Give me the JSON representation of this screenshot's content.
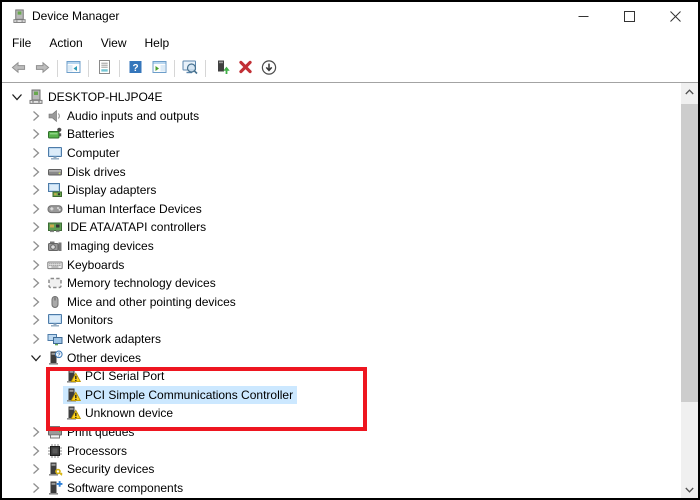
{
  "window": {
    "title": "Device Manager",
    "app_icon": "device-manager-icon",
    "controls": [
      {
        "name": "minimize",
        "icon": "minimize-icon"
      },
      {
        "name": "maximize",
        "icon": "maximize-icon"
      },
      {
        "name": "close",
        "icon": "close-icon"
      }
    ]
  },
  "menu": {
    "items": [
      "File",
      "Action",
      "View",
      "Help"
    ]
  },
  "toolbar": {
    "buttons": [
      {
        "name": "back",
        "icon": "back-arrow"
      },
      {
        "name": "forward",
        "icon": "forward-arrow"
      },
      {
        "sep": true
      },
      {
        "name": "show-console-tree",
        "icon": "console-tree"
      },
      {
        "sep": true
      },
      {
        "name": "properties",
        "icon": "properties"
      },
      {
        "sep": true
      },
      {
        "name": "help",
        "icon": "help"
      },
      {
        "name": "show-action-pane",
        "icon": "action-pane"
      },
      {
        "sep": true
      },
      {
        "name": "scan-for-hardware-changes",
        "icon": "scan"
      },
      {
        "sep": true
      },
      {
        "name": "update-driver",
        "icon": "update-driver"
      },
      {
        "name": "uninstall-device",
        "icon": "uninstall"
      },
      {
        "name": "disable-device",
        "icon": "disable"
      }
    ]
  },
  "tree": {
    "items": [
      {
        "label": "DESKTOP-HLJPO4E",
        "icon": "computer-root",
        "level": 0,
        "state": "expanded",
        "selected": false
      },
      {
        "label": "Audio inputs and outputs",
        "icon": "speaker",
        "level": 1,
        "state": "collapsed",
        "selected": false
      },
      {
        "label": "Batteries",
        "icon": "battery",
        "level": 1,
        "state": "collapsed",
        "selected": false
      },
      {
        "label": "Computer",
        "icon": "monitor",
        "level": 1,
        "state": "collapsed",
        "selected": false
      },
      {
        "label": "Disk drives",
        "icon": "disk",
        "level": 1,
        "state": "collapsed",
        "selected": false
      },
      {
        "label": "Display adapters",
        "icon": "display-adapter",
        "level": 1,
        "state": "collapsed",
        "selected": false
      },
      {
        "label": "Human Interface Devices",
        "icon": "gamepad",
        "level": 1,
        "state": "collapsed",
        "selected": false
      },
      {
        "label": "IDE ATA/ATAPI controllers",
        "icon": "pci-card",
        "level": 1,
        "state": "collapsed",
        "selected": false
      },
      {
        "label": "Imaging devices",
        "icon": "camera",
        "level": 1,
        "state": "collapsed",
        "selected": false
      },
      {
        "label": "Keyboards",
        "icon": "keyboard",
        "level": 1,
        "state": "collapsed",
        "selected": false
      },
      {
        "label": "Memory technology devices",
        "icon": "memory",
        "level": 1,
        "state": "collapsed",
        "selected": false
      },
      {
        "label": "Mice and other pointing devices",
        "icon": "mouse",
        "level": 1,
        "state": "collapsed",
        "selected": false
      },
      {
        "label": "Monitors",
        "icon": "monitor",
        "level": 1,
        "state": "collapsed",
        "selected": false
      },
      {
        "label": "Network adapters",
        "icon": "network",
        "level": 1,
        "state": "collapsed",
        "selected": false
      },
      {
        "label": "Other devices",
        "icon": "device-question",
        "level": 1,
        "state": "expanded",
        "selected": false
      },
      {
        "label": "PCI Serial Port",
        "icon": "device-warning",
        "level": 2,
        "state": "none",
        "selected": false
      },
      {
        "label": "PCI Simple Communications Controller",
        "icon": "device-warning",
        "level": 2,
        "state": "none",
        "selected": true
      },
      {
        "label": "Unknown device",
        "icon": "device-warning",
        "level": 2,
        "state": "none",
        "selected": false
      },
      {
        "label": "Print queues",
        "icon": "printer",
        "level": 1,
        "state": "collapsed",
        "selected": false
      },
      {
        "label": "Processors",
        "icon": "processor",
        "level": 1,
        "state": "collapsed",
        "selected": false
      },
      {
        "label": "Security devices",
        "icon": "device-key",
        "level": 1,
        "state": "collapsed",
        "selected": false
      },
      {
        "label": "Software components",
        "icon": "device-plus",
        "level": 1,
        "state": "collapsed",
        "selected": false
      }
    ]
  },
  "scrollbar": {
    "up_icon": "scroll-up-arrow",
    "down_icon": "scroll-down-arrow"
  },
  "annotation": {
    "shape": "rectangle",
    "color": "#ee1620"
  },
  "colors": {
    "selection_background": "#cce8ff",
    "scrollbar_track": "#f0f0f0",
    "scrollbar_thumb": "#cdcdcd"
  }
}
